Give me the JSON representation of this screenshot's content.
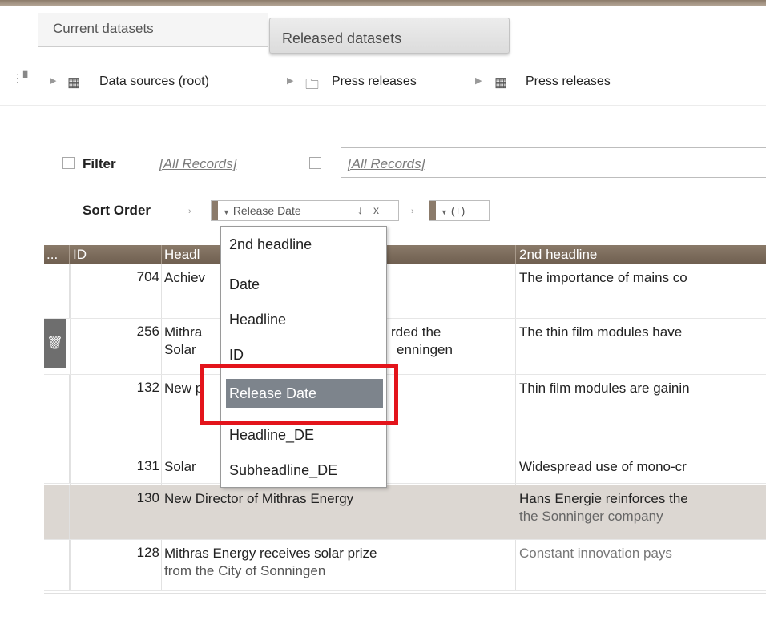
{
  "tabs": {
    "current": "Current datasets",
    "released": "Released datasets"
  },
  "breadcrumb": {
    "root": "Data sources (root)",
    "folder": "Press releases",
    "table": "Press releases"
  },
  "filter": {
    "label": "Filter",
    "link1": "[All Records]",
    "link2": "[All Records]"
  },
  "sort": {
    "label": "Sort Order",
    "field": "Release Date",
    "direction": "↓",
    "remove": "x",
    "add": "(+)"
  },
  "table": {
    "columns": {
      "dots": "...",
      "id": "ID",
      "headline": "Headl",
      "subheadline": "2nd headline"
    },
    "rows": [
      {
        "id": "704",
        "headline": "Achiev",
        "sub": "The importance of mains co"
      },
      {
        "id": "256",
        "headline_a": "Mithra",
        "headline_b": "rded the",
        "headline_c": "Solar",
        "headline_d": "enningen",
        "sub": "The thin film modules have"
      },
      {
        "id": "132",
        "headline": "New p",
        "sub": "Thin film modules are gainin"
      },
      {
        "id": "131",
        "headline": "Solar",
        "sub": "Widespread use of mono-cr"
      },
      {
        "id": "130",
        "headline": "New Director of Mithras Energy",
        "sub": "Hans Energie reinforces the",
        "sub2": "the Sonninger company"
      },
      {
        "id": "128",
        "headline": "Mithras Energy receives solar prize",
        "headline2": "from the City of Sonningen",
        "sub": "Constant innovation pays"
      }
    ]
  },
  "dropdown": {
    "options": [
      "2nd headline",
      "Date",
      "Headline",
      "ID",
      "Release Date",
      "Headline_DE",
      "Subheadline_DE"
    ],
    "selected": "Release Date"
  },
  "colors": {
    "accent": "#7d6d5d",
    "highlight": "#e3141b",
    "selected_option": "#7d848c"
  }
}
